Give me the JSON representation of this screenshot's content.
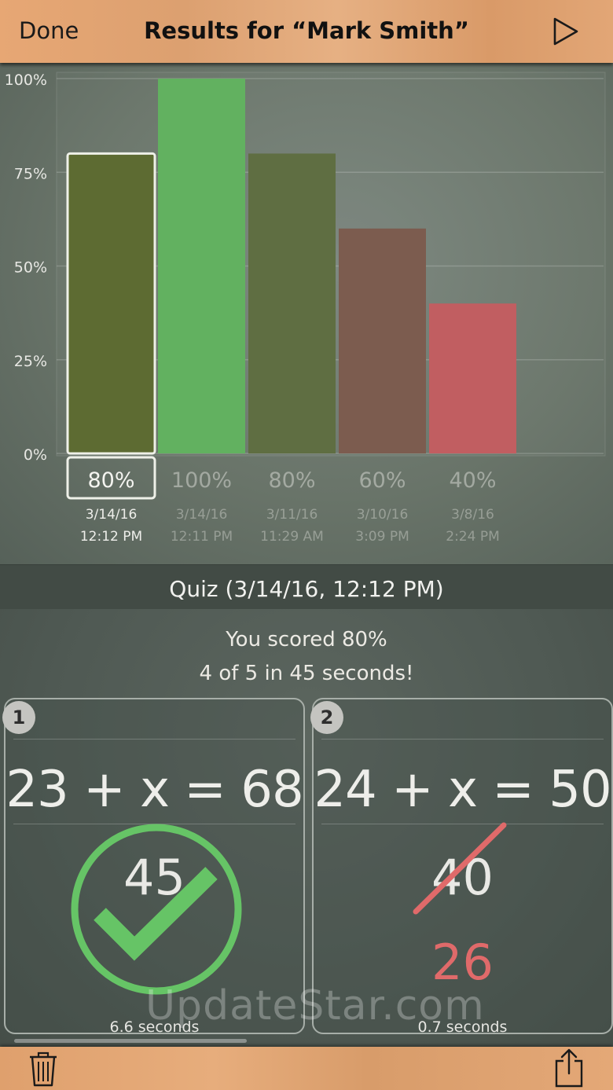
{
  "header": {
    "done_label": "Done",
    "title": "Results for “Mark Smith”",
    "play_icon": "play-icon"
  },
  "chart_data": {
    "type": "bar",
    "y_ticks": [
      "100%",
      "75%",
      "50%",
      "25%",
      "0%"
    ],
    "ylim": [
      0,
      100
    ],
    "grid": true,
    "selected_index": 0,
    "categories": [
      {
        "value": 80,
        "label": "80%",
        "date": "3/14/16",
        "time": "12:12 PM",
        "color": "#5d6b32"
      },
      {
        "value": 100,
        "label": "100%",
        "date": "3/14/16",
        "time": "12:11 PM",
        "color": "#62b160"
      },
      {
        "value": 80,
        "label": "80%",
        "date": "3/11/16",
        "time": "11:29 AM",
        "color": "#5f6e42"
      },
      {
        "value": 60,
        "label": "60%",
        "date": "3/10/16",
        "time": "3:09 PM",
        "color": "#7c5c4f"
      },
      {
        "value": 40,
        "label": "40%",
        "date": "3/8/16",
        "time": "2:24 PM",
        "color": "#c15e61"
      }
    ]
  },
  "quiz": {
    "title": "Quiz (3/14/16, 12:12 PM)",
    "score_line": "You scored 80%",
    "summary_line": "4 of 5 in 45 seconds!"
  },
  "questions": [
    {
      "number": "1",
      "equation": "23 + x = 68",
      "answer": "45",
      "result": "correct",
      "time": "6.6 seconds"
    },
    {
      "number": "2",
      "equation": "24 + x = 50",
      "answer": "40",
      "correct_answer": "26",
      "result": "wrong",
      "time": "0.7 seconds"
    }
  ],
  "colors": {
    "correct_green": "#66c466",
    "wrong_red": "#e06a6a"
  },
  "watermark": "UpdateStar.com",
  "footer": {
    "trash_icon": "trash-icon",
    "share_icon": "share-icon"
  }
}
